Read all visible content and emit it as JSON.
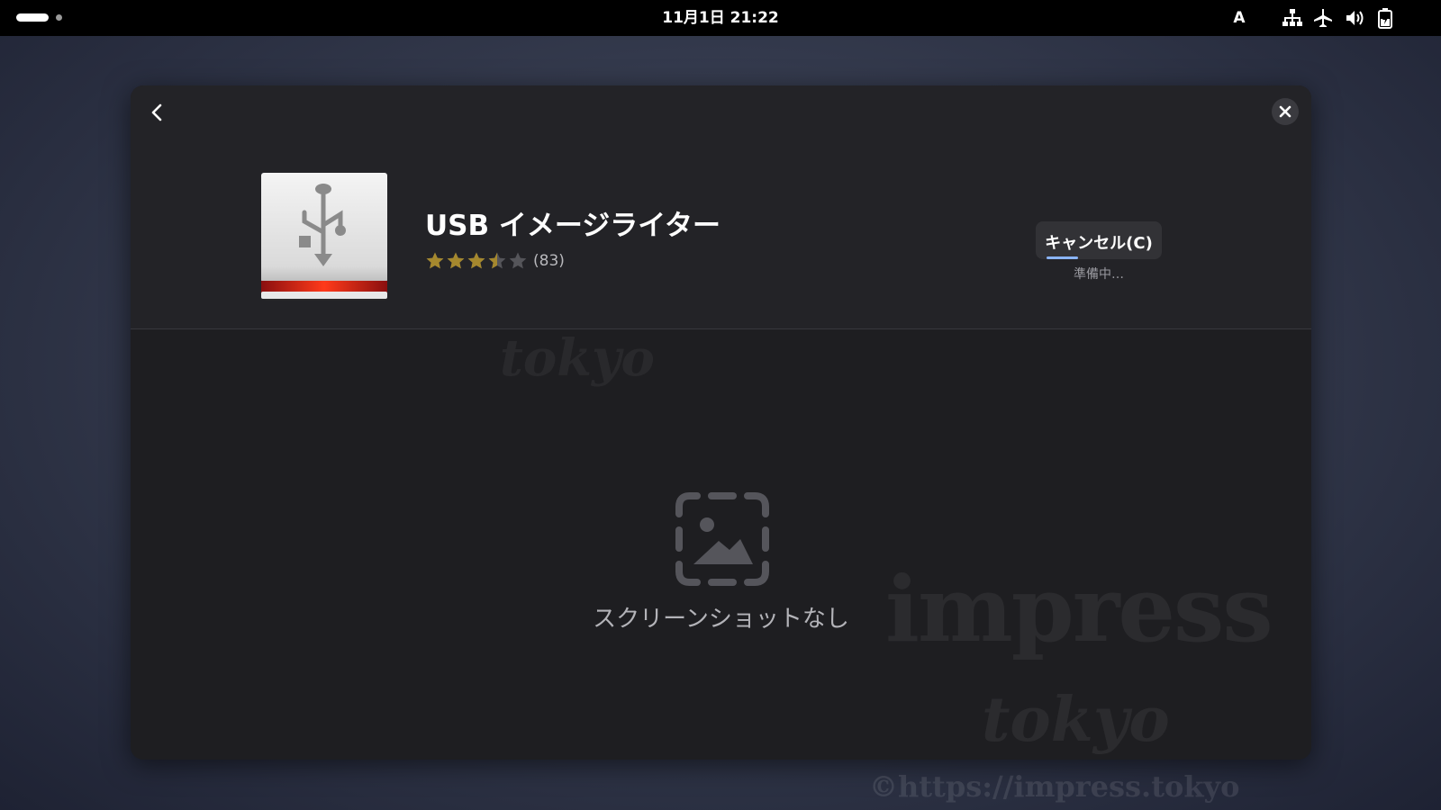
{
  "topbar": {
    "clock": "11月1日  21:22",
    "input_method": "A",
    "icons": [
      "network-wired-icon",
      "airplane-mode-icon",
      "volume-icon",
      "battery-charging-icon"
    ]
  },
  "dialog": {
    "app_name": "USB イメージライター",
    "rating_stars": 3.5,
    "rating_max": 5,
    "rating_count": "(83)",
    "cancel_label": "キャンセル(C)",
    "status": "準備中…",
    "progress": 0.3,
    "no_screenshot": "スクリーンショットなし"
  },
  "watermark": {
    "line1": "impress",
    "line2": "tokyo",
    "url": "©https://impress.tokyo"
  },
  "colors": {
    "star": "#a5882e",
    "star_empty": "#55555a",
    "progress": "#8ab4f8",
    "accent_red": "#d01c1c"
  }
}
